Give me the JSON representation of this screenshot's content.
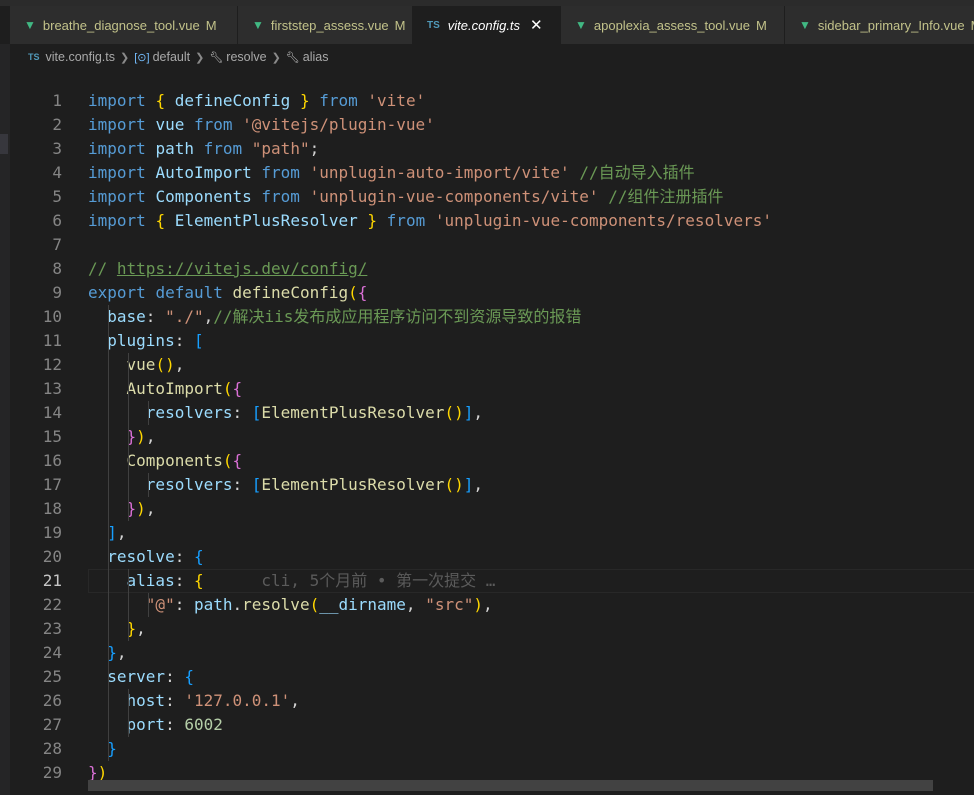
{
  "tabs": [
    {
      "name": "breathe_diagnose_tool.vue",
      "badge": "M",
      "icon": "vue-icon",
      "active": false
    },
    {
      "name": "firststep_assess.vue",
      "badge": "M",
      "icon": "vue-icon",
      "active": false
    },
    {
      "name": "vite.config.ts",
      "badge": "",
      "icon": "ts-icon",
      "active": true
    },
    {
      "name": "apoplexia_assess_tool.vue",
      "badge": "M",
      "icon": "vue-icon",
      "active": false
    },
    {
      "name": "sidebar_primary_Info.vue",
      "badge": "M",
      "icon": "vue-icon",
      "active": false
    }
  ],
  "breadcrumb": {
    "file": "vite.config.ts",
    "file_icon": "TS",
    "items": [
      "default",
      "resolve",
      "alias"
    ]
  },
  "cursor_line": 21,
  "blame": "cli, 5个月前 • 第一次提交 …",
  "lines": [
    [
      [
        "kw",
        "import"
      ],
      [
        "t",
        " "
      ],
      [
        "b1",
        "{"
      ],
      [
        "t",
        " "
      ],
      [
        "var",
        "defineConfig"
      ],
      [
        "t",
        " "
      ],
      [
        "b1",
        "}"
      ],
      [
        "t",
        " "
      ],
      [
        "kw",
        "from"
      ],
      [
        "t",
        " "
      ],
      [
        "str",
        "'vite'"
      ]
    ],
    [
      [
        "kw",
        "import"
      ],
      [
        "t",
        " "
      ],
      [
        "var",
        "vue"
      ],
      [
        "t",
        " "
      ],
      [
        "kw",
        "from"
      ],
      [
        "t",
        " "
      ],
      [
        "str",
        "'@vitejs/plugin-vue'"
      ]
    ],
    [
      [
        "kw",
        "import"
      ],
      [
        "t",
        " "
      ],
      [
        "var",
        "path"
      ],
      [
        "t",
        " "
      ],
      [
        "kw",
        "from"
      ],
      [
        "t",
        " "
      ],
      [
        "str",
        "\"path\""
      ],
      [
        "t",
        ";"
      ]
    ],
    [
      [
        "kw",
        "import"
      ],
      [
        "t",
        " "
      ],
      [
        "var",
        "AutoImport"
      ],
      [
        "t",
        " "
      ],
      [
        "kw",
        "from"
      ],
      [
        "t",
        " "
      ],
      [
        "str",
        "'unplugin-auto-import/vite'"
      ],
      [
        "t",
        " "
      ],
      [
        "cm",
        "//自动导入插件"
      ]
    ],
    [
      [
        "kw",
        "import"
      ],
      [
        "t",
        " "
      ],
      [
        "var",
        "Components"
      ],
      [
        "t",
        " "
      ],
      [
        "kw",
        "from"
      ],
      [
        "t",
        " "
      ],
      [
        "str",
        "'unplugin-vue-components/vite'"
      ],
      [
        "t",
        " "
      ],
      [
        "cm",
        "//组件注册插件"
      ]
    ],
    [
      [
        "kw",
        "import"
      ],
      [
        "t",
        " "
      ],
      [
        "b1",
        "{"
      ],
      [
        "t",
        " "
      ],
      [
        "var",
        "ElementPlusResolver"
      ],
      [
        "t",
        " "
      ],
      [
        "b1",
        "}"
      ],
      [
        "t",
        " "
      ],
      [
        "kw",
        "from"
      ],
      [
        "t",
        " "
      ],
      [
        "str",
        "'unplugin-vue-components/resolvers'"
      ]
    ],
    [],
    [
      [
        "cm",
        "// "
      ],
      [
        "url",
        "https://vitejs.dev/config/"
      ]
    ],
    [
      [
        "kw",
        "export"
      ],
      [
        "t",
        " "
      ],
      [
        "kw",
        "default"
      ],
      [
        "t",
        " "
      ],
      [
        "fn",
        "defineConfig"
      ],
      [
        "b1",
        "("
      ],
      [
        "b2",
        "{"
      ]
    ],
    [
      [
        "t",
        "  "
      ],
      [
        "pr",
        "base"
      ],
      [
        "t",
        ": "
      ],
      [
        "str",
        "\"./\""
      ],
      [
        "t",
        ","
      ],
      [
        "cm",
        "//解决iis发布成应用程序访问不到资源导致的报错"
      ]
    ],
    [
      [
        "t",
        "  "
      ],
      [
        "pr",
        "plugins"
      ],
      [
        "t",
        ": "
      ],
      [
        "b3",
        "["
      ]
    ],
    [
      [
        "t",
        "    "
      ],
      [
        "fn",
        "vue"
      ],
      [
        "b1",
        "()"
      ],
      [
        "t",
        ","
      ]
    ],
    [
      [
        "t",
        "    "
      ],
      [
        "fn",
        "AutoImport"
      ],
      [
        "b1",
        "("
      ],
      [
        "b2",
        "{"
      ]
    ],
    [
      [
        "t",
        "      "
      ],
      [
        "pr",
        "resolvers"
      ],
      [
        "t",
        ": "
      ],
      [
        "b3",
        "["
      ],
      [
        "fn",
        "ElementPlusResolver"
      ],
      [
        "b1",
        "()"
      ],
      [
        "b3",
        "]"
      ],
      [
        "t",
        ","
      ]
    ],
    [
      [
        "t",
        "    "
      ],
      [
        "b2",
        "}"
      ],
      [
        "b1",
        ")"
      ],
      [
        "t",
        ","
      ]
    ],
    [
      [
        "t",
        "    "
      ],
      [
        "fn",
        "Components"
      ],
      [
        "b1",
        "("
      ],
      [
        "b2",
        "{"
      ]
    ],
    [
      [
        "t",
        "      "
      ],
      [
        "pr",
        "resolvers"
      ],
      [
        "t",
        ": "
      ],
      [
        "b3",
        "["
      ],
      [
        "fn",
        "ElementPlusResolver"
      ],
      [
        "b1",
        "()"
      ],
      [
        "b3",
        "]"
      ],
      [
        "t",
        ","
      ]
    ],
    [
      [
        "t",
        "    "
      ],
      [
        "b2",
        "}"
      ],
      [
        "b1",
        ")"
      ],
      [
        "t",
        ","
      ]
    ],
    [
      [
        "t",
        "  "
      ],
      [
        "b3",
        "]"
      ],
      [
        "t",
        ","
      ]
    ],
    [
      [
        "t",
        "  "
      ],
      [
        "pr",
        "resolve"
      ],
      [
        "t",
        ": "
      ],
      [
        "b3",
        "{"
      ]
    ],
    [
      [
        "t",
        "    "
      ],
      [
        "pr",
        "alias"
      ],
      [
        "t",
        ": "
      ],
      [
        "b1",
        "{"
      ],
      [
        "t",
        "      "
      ],
      [
        "blame",
        "cli, 5个月前 • 第一次提交 …"
      ]
    ],
    [
      [
        "t",
        "      "
      ],
      [
        "str",
        "\"@\""
      ],
      [
        "t",
        ": "
      ],
      [
        "var",
        "path"
      ],
      [
        "t",
        "."
      ],
      [
        "fn",
        "resolve"
      ],
      [
        "b1",
        "("
      ],
      [
        "var",
        "__dirname"
      ],
      [
        "t",
        ", "
      ],
      [
        "str",
        "\"src\""
      ],
      [
        "b1",
        ")"
      ],
      [
        "t",
        ","
      ]
    ],
    [
      [
        "t",
        "    "
      ],
      [
        "b1",
        "}"
      ],
      [
        "t",
        ","
      ]
    ],
    [
      [
        "t",
        "  "
      ],
      [
        "b3",
        "}"
      ],
      [
        "t",
        ","
      ]
    ],
    [
      [
        "t",
        "  "
      ],
      [
        "pr",
        "server"
      ],
      [
        "t",
        ": "
      ],
      [
        "b3",
        "{"
      ]
    ],
    [
      [
        "t",
        "    "
      ],
      [
        "pr",
        "host"
      ],
      [
        "t",
        ": "
      ],
      [
        "str",
        "'127.0.0.1'"
      ],
      [
        "t",
        ","
      ]
    ],
    [
      [
        "t",
        "    "
      ],
      [
        "pr",
        "port"
      ],
      [
        "t",
        ": "
      ],
      [
        "nm",
        "6002"
      ]
    ],
    [
      [
        "t",
        "  "
      ],
      [
        "b3",
        "}"
      ]
    ],
    [
      [
        "b2",
        "}"
      ],
      [
        "b1",
        ")"
      ]
    ]
  ],
  "colors": {
    "editor_bg": "#1e1e1e",
    "tab_bg": "#2d2d2d",
    "keyword": "#569cd6",
    "string": "#ce9178",
    "comment": "#6a9955",
    "function": "#dcdcaa",
    "property": "#9cdcfe"
  }
}
